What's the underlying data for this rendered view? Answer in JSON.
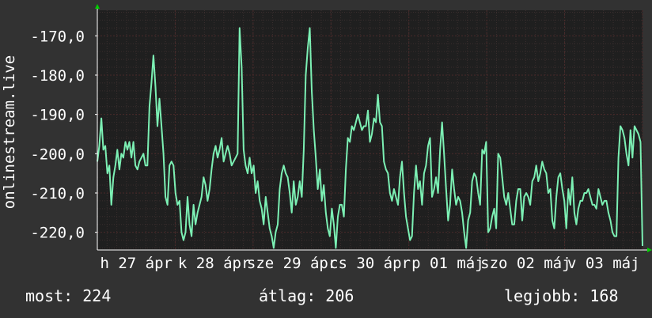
{
  "chart_data": {
    "type": "line",
    "ylabel": "onlinestream.live",
    "ylim": [
      -224.5,
      -163.5
    ],
    "yticks": [
      -170,
      -180,
      -190,
      -200,
      -210,
      -220
    ],
    "ytick_labels": [
      "-170,0",
      "-180,0",
      "-190,0",
      "-200,0",
      "-210,0",
      "-220,0"
    ],
    "xtick_labels": [
      "h 27 ápr",
      "k 28 ápr",
      "sze 29 ápr",
      "cs 30 ápr",
      "p 01 máj",
      "szo 02 máj",
      "v 03 máj"
    ],
    "x_range": [
      0,
      7
    ],
    "grid": true,
    "colors": {
      "background": "#323232",
      "plot": "#1f1f1f",
      "grid": "#4a2a2a",
      "line": "#7cf0b4",
      "axis": "#ffffff",
      "arrow": "#00cc00"
    },
    "series": [
      {
        "values": [
          -202,
          -198,
          -191,
          -199,
          -198,
          -205,
          -203,
          -213,
          -206,
          -203,
          -199,
          -204,
          -200,
          -201,
          -197,
          -199,
          -197,
          -201,
          -197,
          -203,
          -204,
          -202,
          -201,
          -200,
          -203,
          -203,
          -188,
          -182,
          -175,
          -183,
          -193,
          -186,
          -193,
          -200,
          -211,
          -213,
          -203,
          -202,
          -203,
          -210,
          -213,
          -212,
          -220,
          -222,
          -220,
          -211,
          -218,
          -221,
          -213,
          -218,
          -215,
          -213,
          -211,
          -206,
          -208,
          -212,
          -209,
          -204,
          -200,
          -198,
          -201,
          -199,
          -196,
          -202,
          -200,
          -198,
          -200,
          -203,
          -202,
          -201,
          -200,
          -168,
          -178,
          -199,
          -203,
          -205,
          -201,
          -205,
          -203,
          -210,
          -207,
          -212,
          -214,
          -218,
          -211,
          -215,
          -219,
          -221,
          -224,
          -220,
          -218,
          -209,
          -205,
          -203,
          -205,
          -206,
          -210,
          -215,
          -207,
          -213,
          -211,
          -207,
          -211,
          -199,
          -180,
          -173,
          -168,
          -184,
          -194,
          -201,
          -209,
          -204,
          -212,
          -208,
          -215,
          -219,
          -221,
          -214,
          -218,
          -224,
          -216,
          -213,
          -213,
          -216,
          -204,
          -196,
          -197,
          -193,
          -194,
          -192,
          -190,
          -192,
          -194,
          -193,
          -193,
          -189,
          -197,
          -195,
          -191,
          -192,
          -185,
          -192,
          -193,
          -202,
          -204,
          -205,
          -210,
          -212,
          -209,
          -211,
          -213,
          -206,
          -202,
          -210,
          -216,
          -219,
          -222,
          -221,
          -210,
          -203,
          -209,
          -207,
          -213,
          -205,
          -203,
          -198,
          -196,
          -211,
          -209,
          -206,
          -210,
          -199,
          -192,
          -200,
          -209,
          -217,
          -213,
          -204,
          -209,
          -213,
          -211,
          -212,
          -215,
          -220,
          -224,
          -217,
          -215,
          -207,
          -205,
          -206,
          -210,
          -213,
          -199,
          -200,
          -197,
          -220,
          -219,
          -216,
          -214,
          -219,
          -200,
          -201,
          -206,
          -211,
          -213,
          -210,
          -214,
          -218,
          -218,
          -212,
          -209,
          -209,
          -217,
          -211,
          -210,
          -211,
          -213,
          -207,
          -206,
          -203,
          -207,
          -205,
          -202,
          -204,
          -205,
          -210,
          -209,
          -217,
          -219,
          -211,
          -206,
          -205,
          -209,
          -212,
          -219,
          -209,
          -213,
          -206,
          -215,
          -218,
          -214,
          -212,
          -212,
          -210,
          -210,
          -209,
          -211,
          -213,
          -213,
          -214,
          -209,
          -211,
          -213,
          -212,
          -212,
          -215,
          -217,
          -220,
          -221,
          -221,
          -201,
          -193,
          -194,
          -196,
          -200,
          -203,
          -194,
          -201,
          -193,
          -194,
          -195,
          -197,
          -223.5
        ]
      }
    ],
    "legend": []
  },
  "stats": {
    "most": "most: 224",
    "atlag": "átlag: 206",
    "legjobb": "legjobb: 168"
  }
}
